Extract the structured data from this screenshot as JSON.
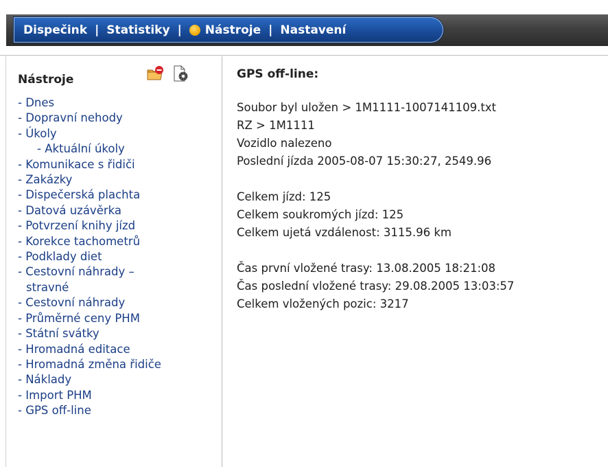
{
  "nav": {
    "items": [
      "Dispečink",
      "Statistiky",
      "Nástroje",
      "Nastavení"
    ],
    "separator": "|",
    "active_index": 2
  },
  "sidebar": {
    "title": "Nástroje",
    "icons": [
      "export-folder-icon",
      "settings-document-icon"
    ],
    "items": [
      "- Dnes",
      "- Dopravní nehody",
      "- Úkoly",
      "- Aktuální úkoly",
      "- Komunikace s řidiči",
      "- Zakázky",
      "- Dispečerská plachta",
      "- Datová uzávěrka",
      "- Potvrzení knihy jízd",
      "- Korekce tachometrů",
      "- Podklady diet",
      "- Cestovní náhrady –",
      "stravné",
      "- Cestovní náhrady",
      "- Průměrné ceny PHM",
      "- Státní svátky",
      "- Hromadná editace",
      "- Hromadná změna řidiče",
      "- Náklady",
      "- Import PHM",
      "- GPS off-line"
    ]
  },
  "main": {
    "title": "GPS off-line:",
    "block1": [
      "Soubor byl uložen > 1M1111-1007141109.txt",
      "RZ > 1M1111",
      "Vozidlo nalezeno",
      "Poslední jízda 2005-08-07 15:30:27, 2549.96"
    ],
    "block2": [
      "Celkem jízd: 125",
      "Celkem soukromých jízd: 125",
      "Celkem ujetá vzdálenost: 3115.96 km"
    ],
    "block3": [
      "Čas první vložené trasy: 13.08.2005 18:21:08",
      "Čas poslední vložené trasy: 29.08.2005 13:03:57",
      "Celkem vložených pozic: 3217"
    ]
  },
  "colors": {
    "nav_pill": "#1c4f9e",
    "nav_band": "#3f3f3f",
    "active_dot": "#f0a800",
    "link": "#1b3e86"
  }
}
